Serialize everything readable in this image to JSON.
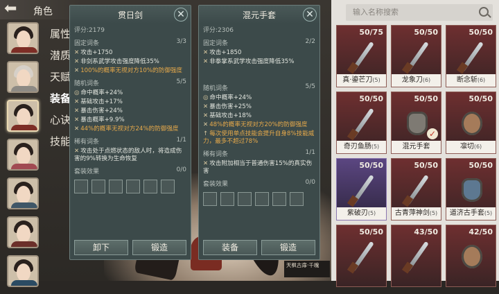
{
  "header": {
    "back_icon": "back-arrow-icon",
    "title": "角色"
  },
  "menu": [
    "属性",
    "潜质",
    "天赋",
    "装备",
    "心诀",
    "技能"
  ],
  "panel_left": {
    "title": "贯日剑",
    "score_label": "评分:",
    "score": "2179",
    "fixed_label": "固定词条",
    "fixed_count": "3/3",
    "fixed": [
      "攻击+1750",
      "非剑系武学攻击强度降低35%",
      "100%的概率无视对方10%的防御强度"
    ],
    "random_label": "随机词条",
    "random_count": "5/5",
    "random": [
      "命中概率+24%",
      "基础攻击+17%",
      "暴击伤害+24%",
      "暴击概率+9.9%",
      "44%的概率无视对方24%的防御强度"
    ],
    "rare_label": "稀有词条",
    "rare_count": "1/1",
    "rare": [
      "攻击处于点燃状态的敌人时，将造成伤害的9%转换为生命恢复"
    ],
    "set_label": "套装效果",
    "set_count": "0/0",
    "btn_a": "卸下",
    "btn_b": "锻造"
  },
  "panel_right": {
    "title": "混元手套",
    "score_label": "评分:",
    "score": "2306",
    "fixed_label": "固定词条",
    "fixed_count": "2/2",
    "fixed": [
      "攻击+1850",
      "非拳掌系武学攻击强度降低35%"
    ],
    "random_label": "随机词条",
    "random_count": "5/5",
    "random": [
      "命中概率+24%",
      "暴击伤害+25%",
      "基础攻击+18%",
      "48%的概率无视对方20%的防御强度",
      "每次使用单点技能会提升自身8%技能威力，最多不超过78%"
    ],
    "rare_label": "稀有词条",
    "rare_count": "1/1",
    "rare": [
      "攻击附加相当于普通伤害15%的真实伤害"
    ],
    "set_label": "套装效果",
    "set_count": "0/0",
    "btn_a": "装备",
    "btn_b": "锻造"
  },
  "caption": "天枫古扉·千魄",
  "search": {
    "placeholder": "输入名称搜索"
  },
  "items": [
    {
      "name": "真·鎏芒刀",
      "lv": "(5)",
      "count": "50/75",
      "kind": "sword",
      "purple": false
    },
    {
      "name": "龙象刀",
      "lv": "(6)",
      "count": "50/50",
      "kind": "sword",
      "purple": false
    },
    {
      "name": "断念斩",
      "lv": "(6)",
      "count": "50/50",
      "kind": "sword",
      "purple": false
    },
    {
      "name": "奇刃鱼肠",
      "lv": "(5)",
      "count": "50/50",
      "kind": "sword",
      "purple": false
    },
    {
      "name": "混元手套",
      "lv": "",
      "count": "50/50",
      "kind": "glove",
      "purple": false,
      "checked": true
    },
    {
      "name": "凛切",
      "lv": "(6)",
      "count": "50/50",
      "kind": "glove-r",
      "purple": false
    },
    {
      "name": "紫破刃",
      "lv": "(5)",
      "count": "50/50",
      "kind": "sword",
      "purple": true
    },
    {
      "name": "古青萍神剑",
      "lv": "(5)",
      "count": "50/50",
      "kind": "sword",
      "purple": false
    },
    {
      "name": "道济古手套",
      "lv": "(5)",
      "count": "50/50",
      "kind": "glove-b",
      "purple": false
    },
    {
      "name": "",
      "lv": "",
      "count": "50/50",
      "kind": "sword",
      "purple": false
    },
    {
      "name": "",
      "lv": "",
      "count": "43/50",
      "kind": "sword",
      "purple": false
    },
    {
      "name": "",
      "lv": "",
      "count": "42/50",
      "kind": "glove-r",
      "purple": false
    }
  ]
}
